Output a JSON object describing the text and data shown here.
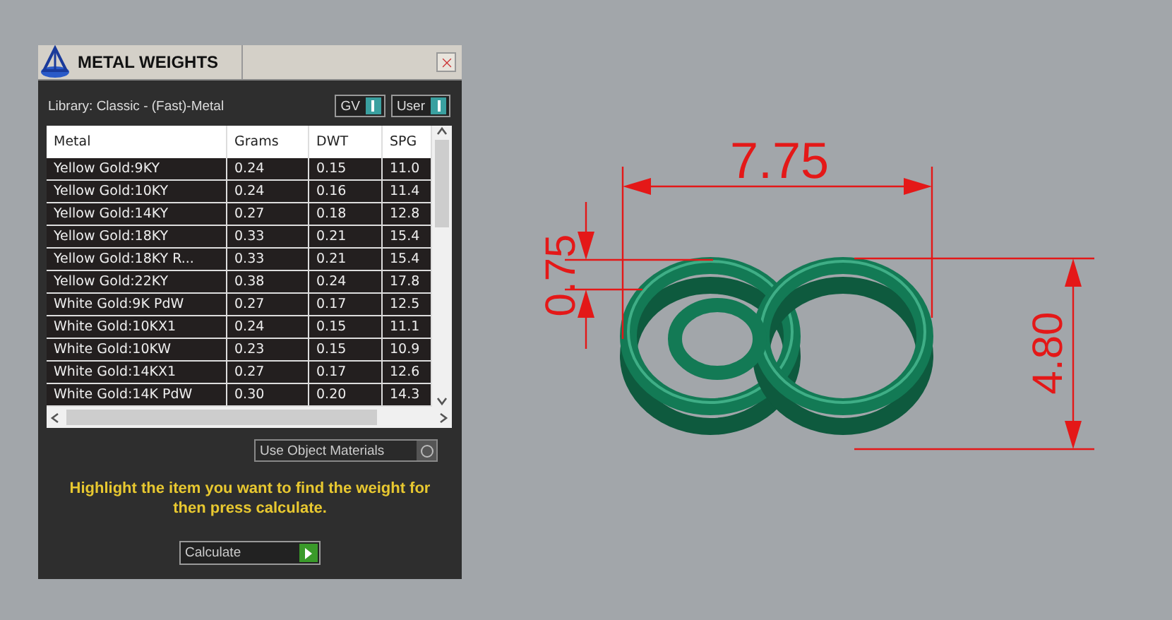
{
  "panel": {
    "title": "METAL WEIGHTS",
    "library": "Library: Classic - (Fast)-Metal",
    "toggles": [
      {
        "label": "GV",
        "on": true
      },
      {
        "label": "User",
        "on": true
      }
    ],
    "table": {
      "columns": [
        "Metal",
        "Grams",
        "DWT",
        "SPG"
      ],
      "rows": [
        {
          "metal": "Yellow Gold:9KY",
          "grams": "0.24",
          "dwt": "0.15",
          "spg": "11.0"
        },
        {
          "metal": "Yellow Gold:10KY",
          "grams": "0.24",
          "dwt": "0.16",
          "spg": "11.4"
        },
        {
          "metal": "Yellow Gold:14KY",
          "grams": "0.27",
          "dwt": "0.18",
          "spg": "12.8"
        },
        {
          "metal": "Yellow Gold:18KY",
          "grams": "0.33",
          "dwt": "0.21",
          "spg": "15.4"
        },
        {
          "metal": "Yellow Gold:18KY R...",
          "grams": "0.33",
          "dwt": "0.21",
          "spg": "15.4"
        },
        {
          "metal": "Yellow Gold:22KY",
          "grams": "0.38",
          "dwt": "0.24",
          "spg": "17.8"
        },
        {
          "metal": "White Gold:9K PdW",
          "grams": "0.27",
          "dwt": "0.17",
          "spg": "12.5"
        },
        {
          "metal": "White Gold:10KX1",
          "grams": "0.24",
          "dwt": "0.15",
          "spg": "11.1"
        },
        {
          "metal": "White Gold:10KW",
          "grams": "0.23",
          "dwt": "0.15",
          "spg": "10.9"
        },
        {
          "metal": "White Gold:14KX1",
          "grams": "0.27",
          "dwt": "0.17",
          "spg": "12.6"
        },
        {
          "metal": "White Gold:14K PdW",
          "grams": "0.30",
          "dwt": "0.20",
          "spg": "14.3"
        }
      ]
    },
    "use_object_materials": {
      "label": "Use Object Materials",
      "on": false
    },
    "hint": "Highlight the item you want to find the weight for then press calculate.",
    "calculate_button": "Calculate"
  },
  "drawing": {
    "width_dimension": "7.75",
    "thickness_dimension": "0.75",
    "height_dimension": "4.80"
  }
}
